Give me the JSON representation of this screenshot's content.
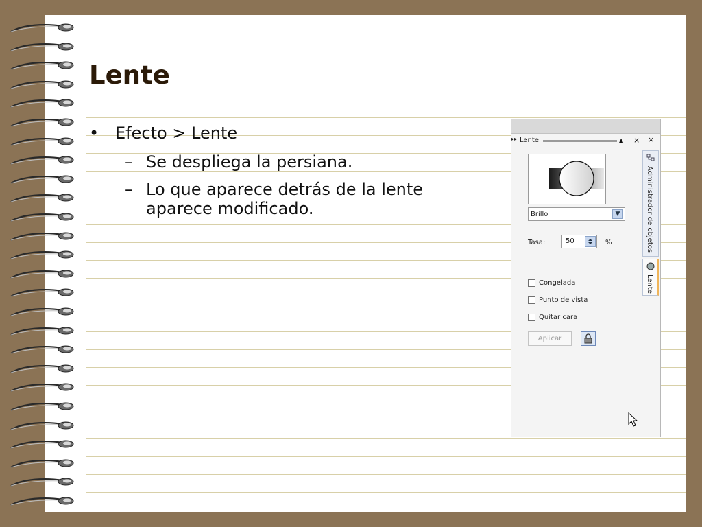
{
  "slide": {
    "title": "Lente",
    "bullets": [
      {
        "text": "Efecto > Lente",
        "subs": [
          {
            "text": "Se despliega la persiana."
          },
          {
            "text": "Lo que aparece detrás de la lente",
            "cont": "aparece modificado."
          }
        ]
      }
    ]
  },
  "panel": {
    "title": "Lente",
    "close_label": "×",
    "collapse_label": "▲",
    "dropdown_value": "Brillo",
    "rate_label": "Tasa:",
    "rate_value": "50",
    "rate_unit": "%",
    "checkboxes": [
      "Congelada",
      "Punto de vista",
      "Quitar cara"
    ],
    "apply_label": "Aplicar",
    "tabs": [
      "Administrador de objetos",
      "Lente"
    ],
    "top_close_label": "×"
  },
  "icons": {
    "bullet": "bullet-dot-icon",
    "dash": "dash-icon",
    "lens_preview": "lens-preview-icon",
    "lock": "lock-icon",
    "cursor": "mouse-pointer-icon"
  },
  "colors": {
    "background": "#8b7355",
    "page": "#ffffff",
    "rule": "#d8d0a8",
    "title": "#2b1a08"
  }
}
